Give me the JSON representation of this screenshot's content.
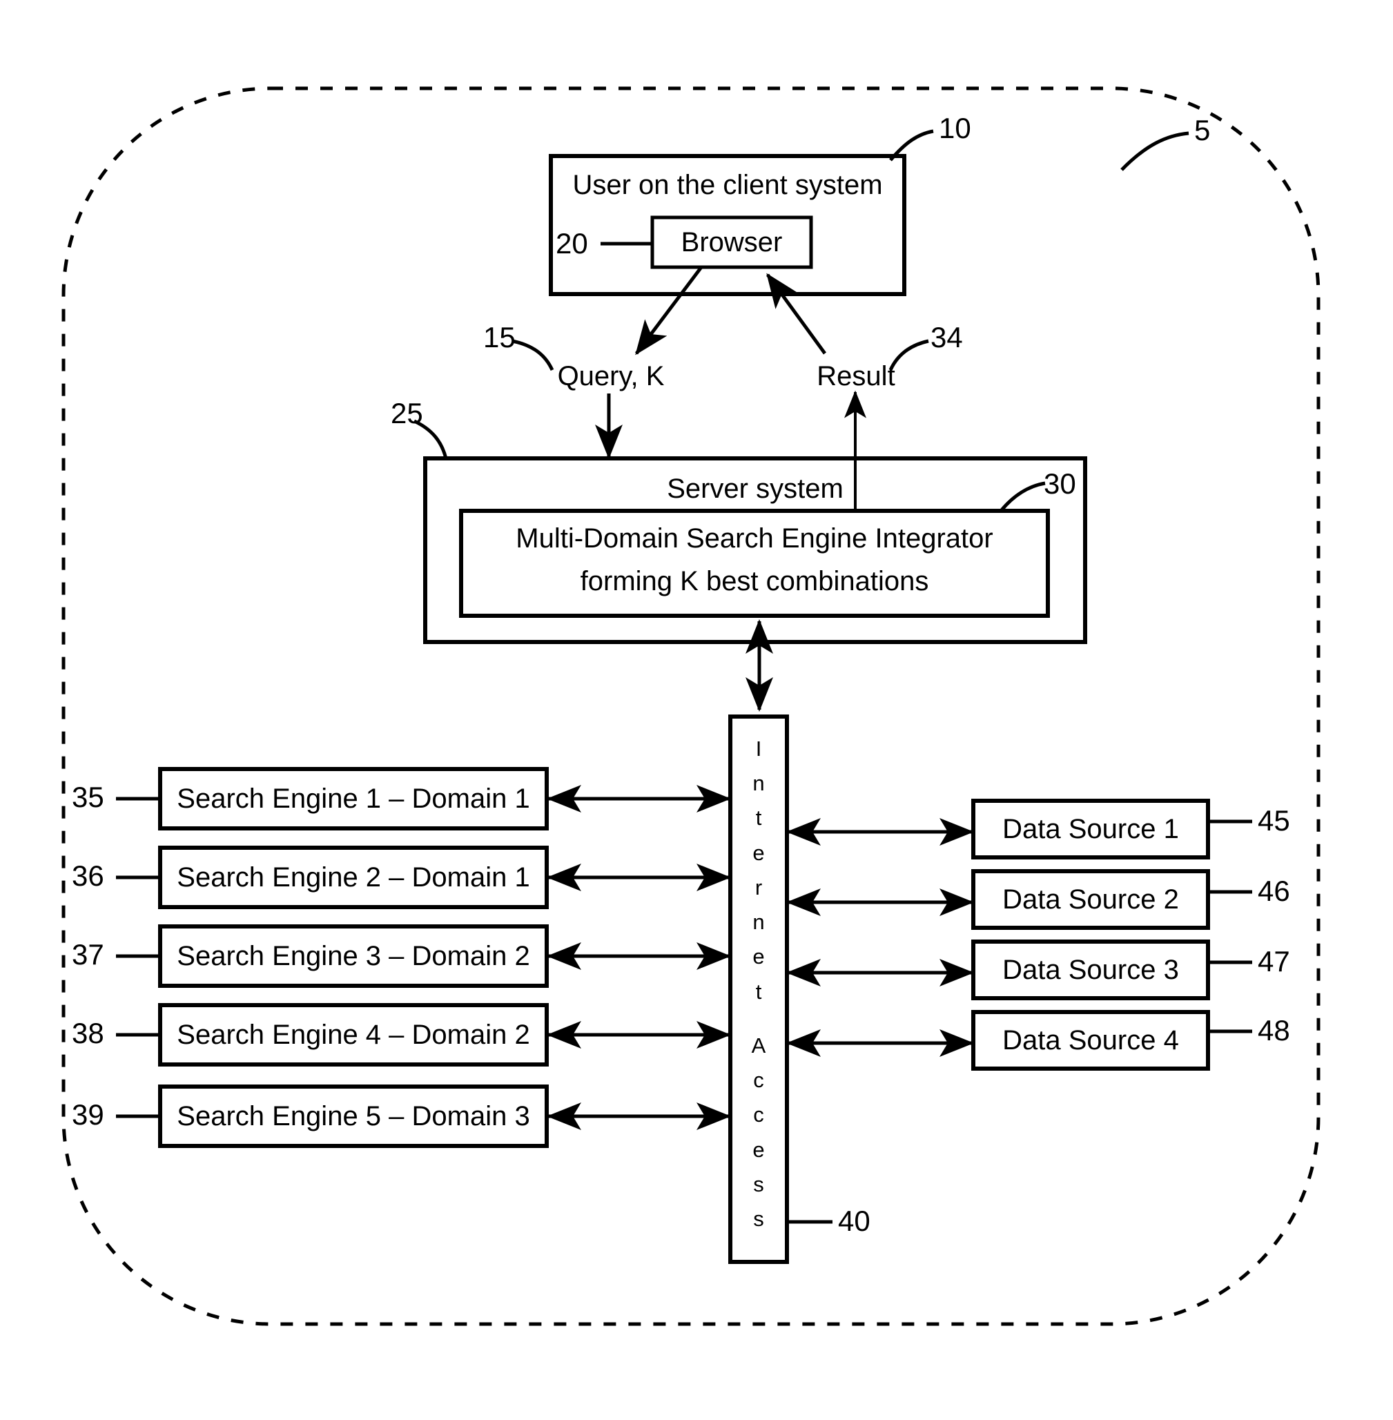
{
  "figure": {
    "outer_boundary_label": "5",
    "client_box": {
      "title": "User on the client system",
      "ref": "10",
      "browser": {
        "label": "Browser",
        "ref": "20"
      }
    },
    "flows": {
      "query": {
        "label": "Query, K",
        "ref": "15"
      },
      "result": {
        "label": "Result",
        "ref": "34"
      }
    },
    "server_box": {
      "title": "Server system",
      "ref": "25",
      "integrator": {
        "line1": "Multi-Domain Search Engine Integrator",
        "line2": "forming K best combinations",
        "ref": "30"
      }
    },
    "internet_access": {
      "ref": "40",
      "letters_top": [
        "I",
        "n",
        "t",
        "e",
        "r",
        "n",
        "e",
        "t"
      ],
      "letters_bottom": [
        "A",
        "c",
        "c",
        "e",
        "s",
        "s"
      ],
      "full_label": "Internet Access"
    },
    "search_engines": [
      {
        "ref": "35",
        "label": "Search Engine 1 – Domain 1"
      },
      {
        "ref": "36",
        "label": "Search Engine 2 – Domain 1"
      },
      {
        "ref": "37",
        "label": "Search Engine 3 – Domain 2"
      },
      {
        "ref": "38",
        "label": "Search Engine 4 – Domain 2"
      },
      {
        "ref": "39",
        "label": "Search Engine 5 – Domain 3"
      }
    ],
    "data_sources": [
      {
        "ref": "45",
        "label": "Data Source 1"
      },
      {
        "ref": "46",
        "label": "Data Source 2"
      },
      {
        "ref": "47",
        "label": "Data Source 3"
      },
      {
        "ref": "48",
        "label": "Data Source 4"
      }
    ],
    "colors": {
      "stroke": "#000000",
      "background": "#ffffff"
    }
  }
}
